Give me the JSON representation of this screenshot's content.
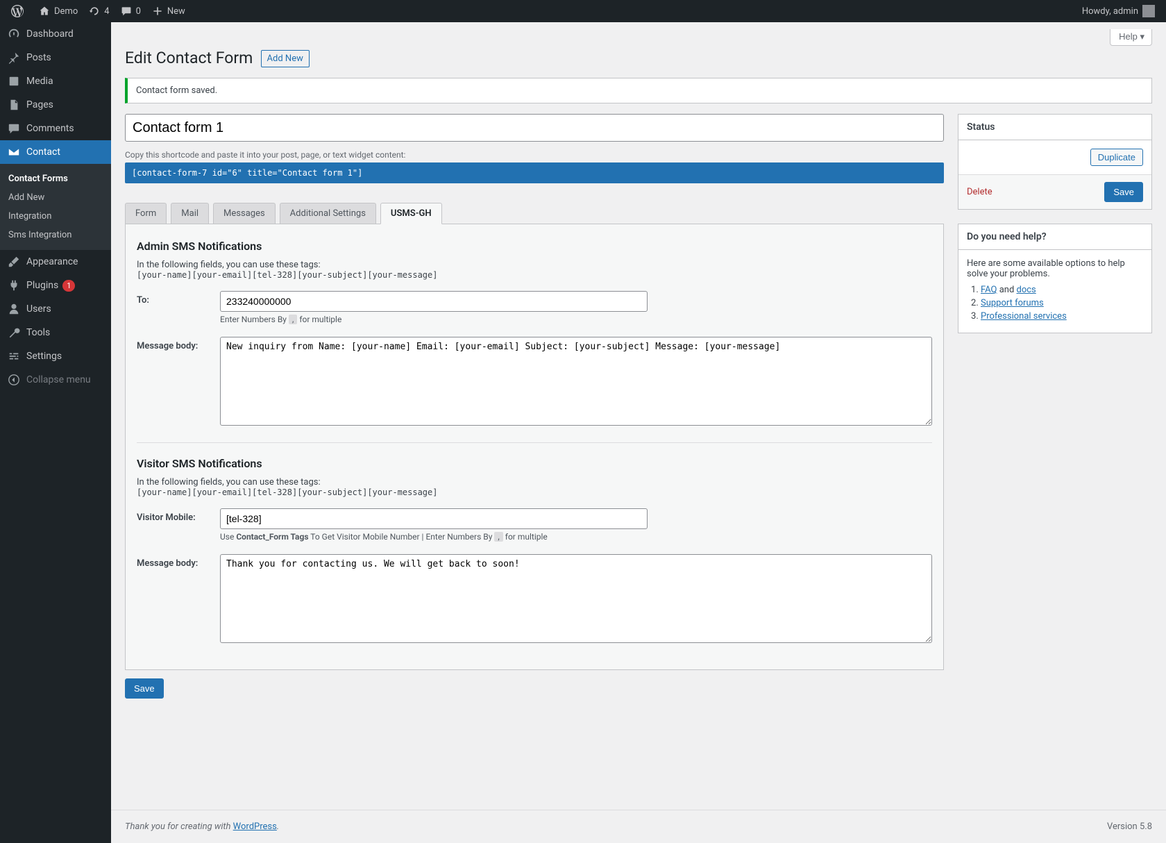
{
  "adminbar": {
    "site_name": "Demo",
    "updates_count": "4",
    "comments_count": "0",
    "new_label": "New",
    "howdy": "Howdy, admin"
  },
  "screen_meta": {
    "help": "Help"
  },
  "sidebar": {
    "items": [
      {
        "label": "Dashboard"
      },
      {
        "label": "Posts"
      },
      {
        "label": "Media"
      },
      {
        "label": "Pages"
      },
      {
        "label": "Comments"
      },
      {
        "label": "Contact"
      },
      {
        "label": "Appearance"
      },
      {
        "label": "Plugins",
        "badge": "1"
      },
      {
        "label": "Users"
      },
      {
        "label": "Tools"
      },
      {
        "label": "Settings"
      },
      {
        "label": "Collapse menu"
      }
    ],
    "submenu": [
      {
        "label": "Contact Forms",
        "current": true
      },
      {
        "label": "Add New"
      },
      {
        "label": "Integration"
      },
      {
        "label": "Sms Integration"
      }
    ]
  },
  "page": {
    "title": "Edit Contact Form",
    "add_new": "Add New",
    "notice": "Contact form saved.",
    "form_title": "Contact form 1",
    "shortcode_hint": "Copy this shortcode and paste it into your post, page, or text widget content:",
    "shortcode": "[contact-form-7 id=\"6\" title=\"Contact form 1\"]"
  },
  "tabs": [
    {
      "label": "Form"
    },
    {
      "label": "Mail"
    },
    {
      "label": "Messages"
    },
    {
      "label": "Additional Settings"
    },
    {
      "label": "USMS-GH",
      "active": true
    }
  ],
  "panel": {
    "admin_title": "Admin SMS Notifications",
    "visitor_title": "Visitor SMS Notifications",
    "tags_intro": "In the following fields, you can use these tags:",
    "tags": "[your-name][your-email][tel-328][your-subject][your-message]",
    "to_label": "To:",
    "to_value": "233240000000",
    "to_hint_1": "Enter Numbers By",
    "to_hint_comma": ",",
    "to_hint_2": "for multiple",
    "body_label": "Message body:",
    "admin_body": "New inquiry from Name: [your-name] Email: [your-email] Subject: [your-subject] Message: [your-message]",
    "visitor_mobile_label": "Visitor Mobile:",
    "visitor_mobile_value": "[tel-328]",
    "visitor_hint_1": "Use",
    "visitor_hint_bold": "Contact_Form Tags",
    "visitor_hint_2": "To Get Visitor Mobile Number | Enter Numbers By",
    "visitor_hint_3": "for multiple",
    "visitor_body": "Thank you for contacting us. We will get back to soon!",
    "save": "Save"
  },
  "status_box": {
    "title": "Status",
    "duplicate": "Duplicate",
    "delete": "Delete",
    "save": "Save"
  },
  "help_box": {
    "title": "Do you need help?",
    "intro": "Here are some available options to help solve your problems.",
    "faq": "FAQ",
    "and": " and ",
    "docs": "docs",
    "forums": "Support forums",
    "pro": "Professional services"
  },
  "footer": {
    "thanks": "Thank you for creating with ",
    "wp": "WordPress",
    "period": ".",
    "version": "Version 5.8"
  }
}
